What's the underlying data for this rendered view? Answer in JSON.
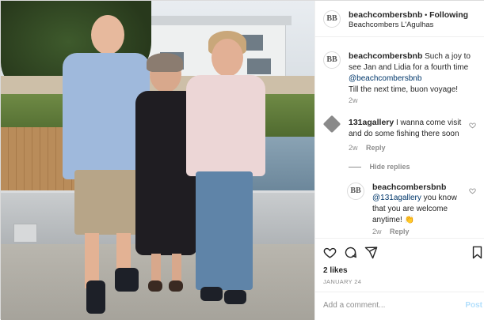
{
  "post": {
    "username": "beachcombersbnb",
    "separator": "•",
    "follow_label": "Following",
    "location": "Beachcombers L'Agulhas",
    "avatar_text": "BB"
  },
  "caption": {
    "username": "beachcombersbnb",
    "text_before": "Such a joy to see Jan and Lidia for a fourth time",
    "mention": "@beachcombersbnb",
    "text_after": "Till the next time, buon voyage!",
    "time": "2w"
  },
  "comments": [
    {
      "username": "131agallery",
      "text": "I wanna come visit and do some fishing there soon",
      "time": "2w",
      "reply_label": "Reply"
    }
  ],
  "hide_replies_label": "Hide replies",
  "reply": {
    "username": "beachcombersbnb",
    "mention": "@131agallery",
    "text": "you know that you are welcome anytime!",
    "emoji": "👏",
    "time": "2w",
    "reply_label": "Reply"
  },
  "stats": {
    "likes": "2 likes",
    "date": "JANUARY 24"
  },
  "add_comment": {
    "placeholder": "Add a comment...",
    "post_label": "Post"
  },
  "icons": {
    "like": "heart-icon",
    "comment": "comment-icon",
    "share": "share-icon",
    "save": "bookmark-icon"
  },
  "colors": {
    "link": "#00376b",
    "muted": "#8e8e8e",
    "post_button": "#b2dffc"
  }
}
